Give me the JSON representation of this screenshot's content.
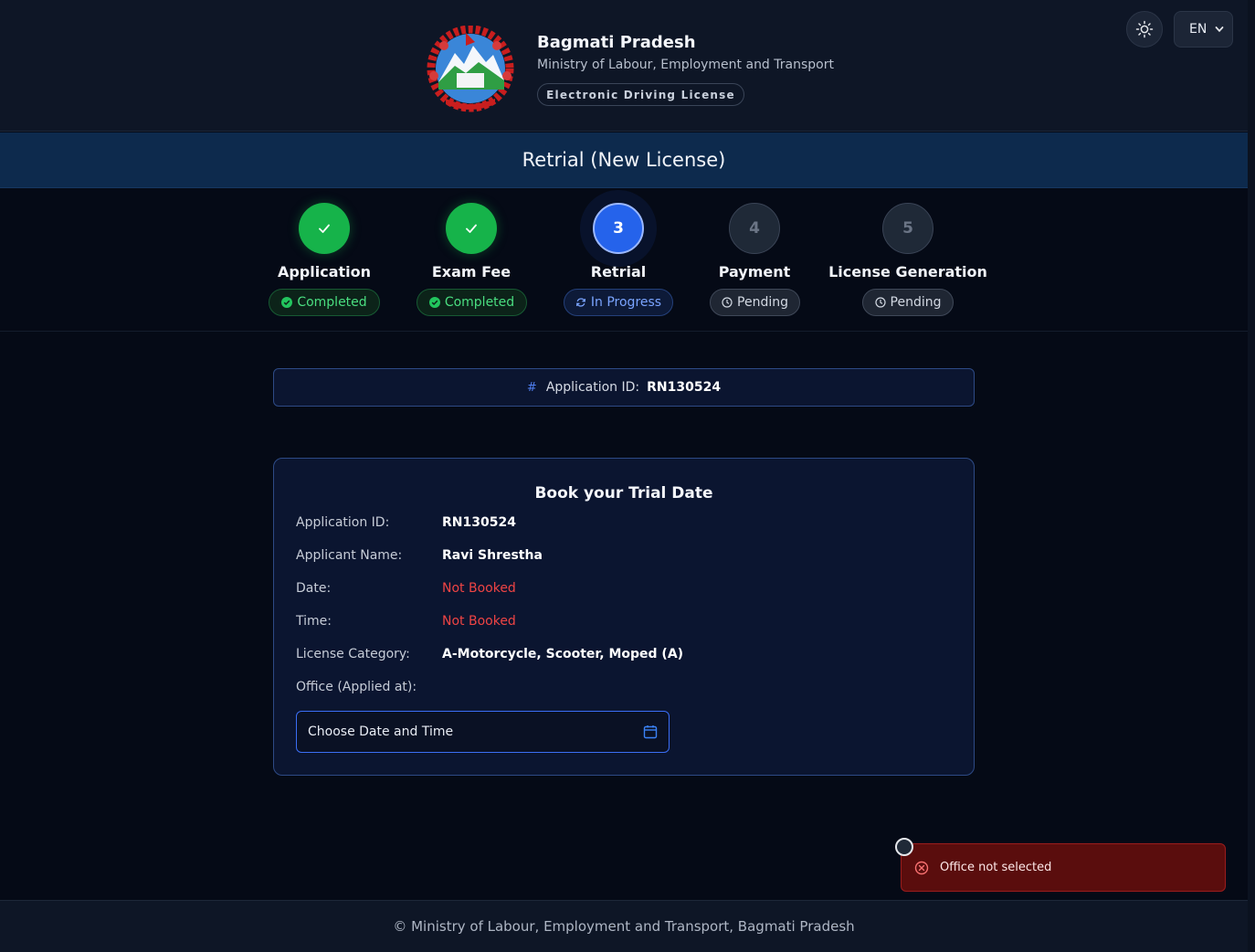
{
  "header": {
    "title": "Bagmati Pradesh",
    "subtitle": "Ministry of Labour, Employment and Transport",
    "badge": "Electronic Driving License",
    "language": "EN"
  },
  "page_title": "Retrial (New License)",
  "steps": [
    {
      "number": "1",
      "label": "Application",
      "status": "Completed",
      "state": "done"
    },
    {
      "number": "2",
      "label": "Exam Fee",
      "status": "Completed",
      "state": "done"
    },
    {
      "number": "3",
      "label": "Retrial",
      "status": "In Progress",
      "state": "active"
    },
    {
      "number": "4",
      "label": "Payment",
      "status": "Pending",
      "state": "pending"
    },
    {
      "number": "5",
      "label": "License Generation",
      "status": "Pending",
      "state": "pending"
    }
  ],
  "application_bar": {
    "hash": "#",
    "label": "Application ID:",
    "value": "RN130524"
  },
  "booking": {
    "title": "Book your Trial Date",
    "rows": [
      {
        "label": "Application ID:",
        "value": "RN130524"
      },
      {
        "label": "Applicant Name:",
        "value": "Ravi Shrestha"
      },
      {
        "label": "Date:",
        "value": "Not Booked"
      },
      {
        "label": "Time:",
        "value": "Not Booked"
      },
      {
        "label": "License Category:",
        "value": "A-Motorcycle, Scooter, Moped (A)"
      },
      {
        "label": "Office (Applied at):",
        "value": ""
      }
    ],
    "date_picker_placeholder": "Choose Date and Time"
  },
  "toast": {
    "message": "Office not selected"
  },
  "footer": {
    "text": "© Ministry of Labour, Employment and Transport, Bagmati Pradesh"
  },
  "colors": {
    "success": "#16b34a",
    "active": "#2563eb",
    "warning_text": "#ef4444",
    "toast_bg": "#5a0d0d"
  }
}
